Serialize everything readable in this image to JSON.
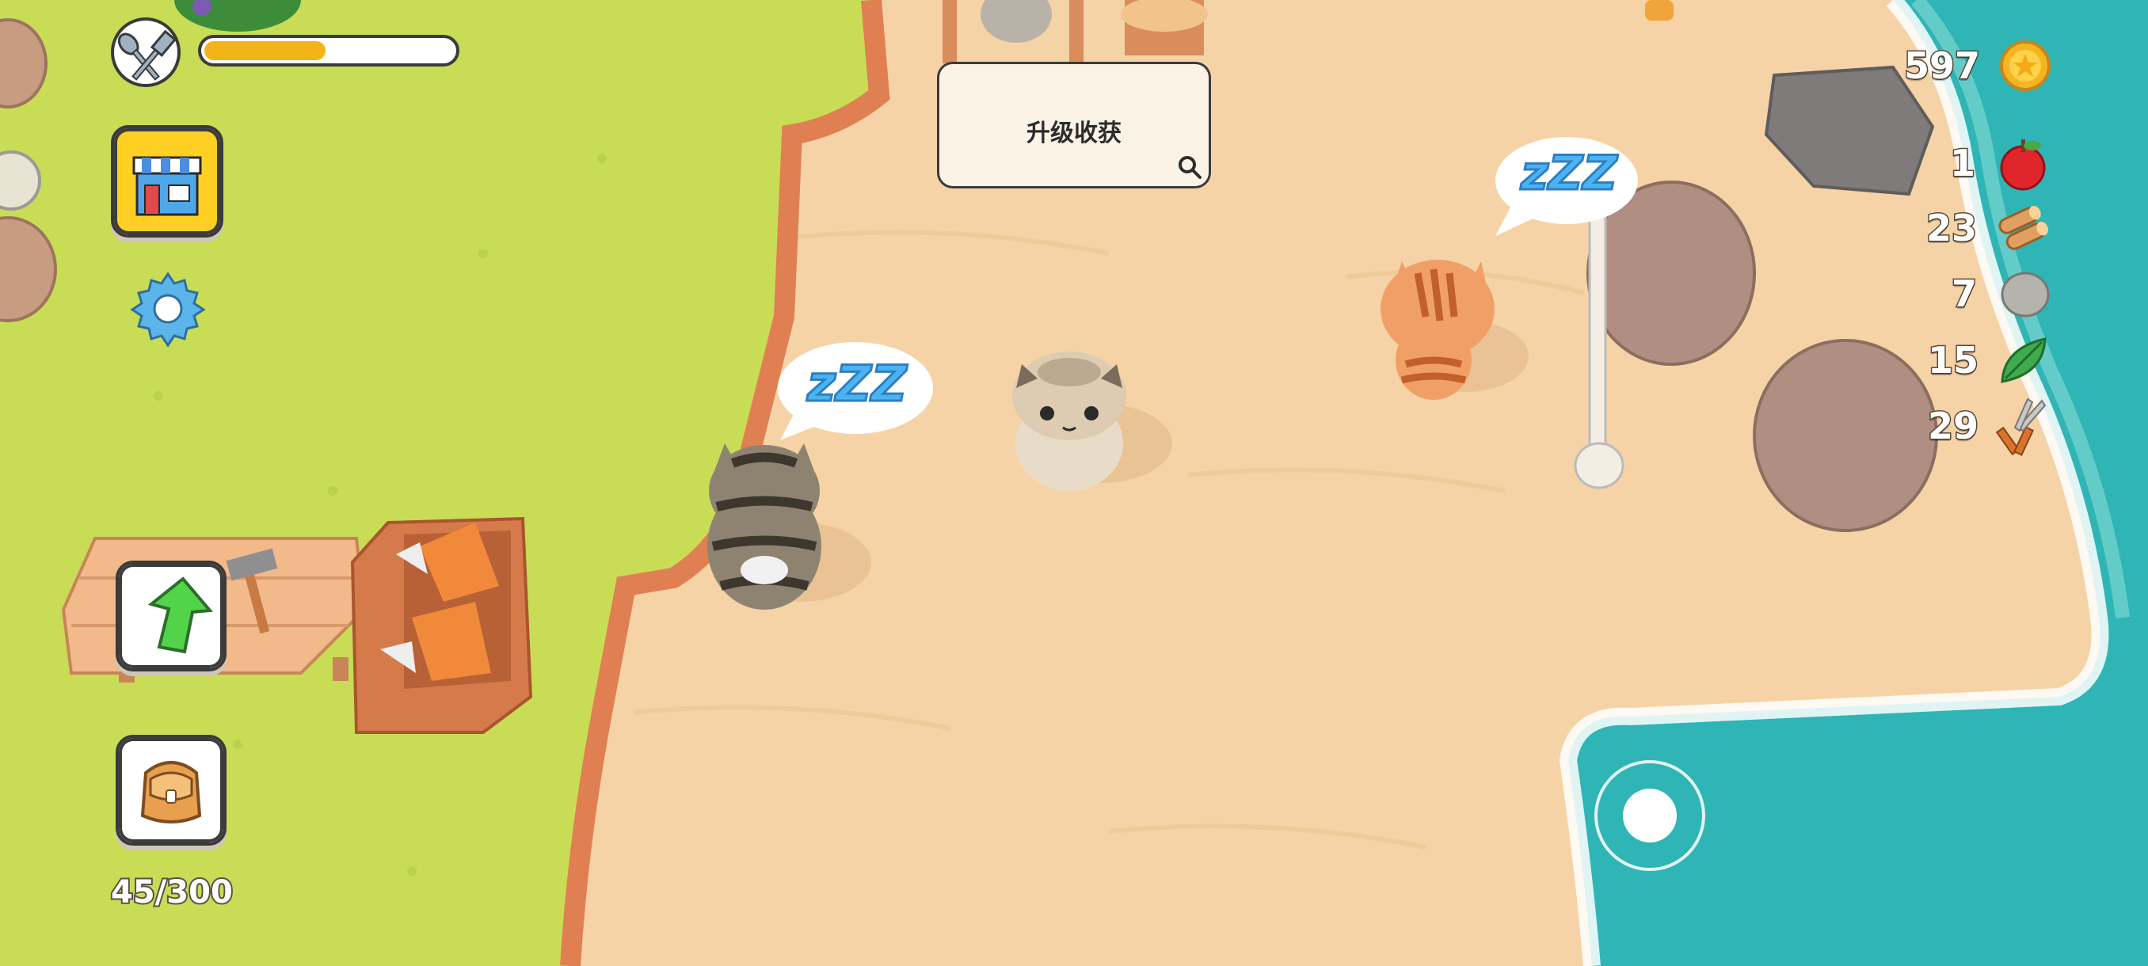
{
  "hud": {
    "hunger_icon": "fork-spoon-icon",
    "hunger_level": 0.5,
    "shop_icon": "shop-icon",
    "settings_icon": "gear-icon",
    "upgrade_icon": "green-up-arrow-icon",
    "bag_icon": "backpack-icon",
    "bag_count": "45/300"
  },
  "harvest_panel": {
    "label": "升级收获",
    "icon": "magnifier-icon"
  },
  "resources": [
    {
      "name": "coins",
      "value": "597",
      "icon": "gold-coin-icon"
    },
    {
      "name": "apples",
      "value": "1",
      "icon": "apple-icon"
    },
    {
      "name": "wood",
      "value": "23",
      "icon": "log-icon"
    },
    {
      "name": "stone",
      "value": "7",
      "icon": "stone-icon"
    },
    {
      "name": "leaves",
      "value": "15",
      "icon": "leaf-icon"
    },
    {
      "name": "tools",
      "value": "29",
      "icon": "shears-icon"
    }
  ],
  "sleep_bubble_text": "zZZ",
  "colors": {
    "grass": "#c9dc55",
    "sand": "#f5d3a6",
    "sea": "#2fb5b5",
    "bar_fill": "#f2b417",
    "coin": "#f5b521"
  }
}
